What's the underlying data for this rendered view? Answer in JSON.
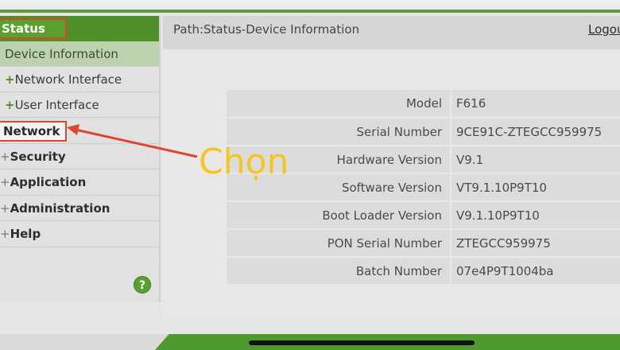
{
  "header": {
    "path": "Path:Status-Device Information",
    "logout": "Logou"
  },
  "sidebar": {
    "status": "Status",
    "sub_items": [
      {
        "label": "Device Information",
        "plus": ""
      },
      {
        "label": "Network Interface",
        "plus": "+"
      },
      {
        "label": "User Interface",
        "plus": "+"
      }
    ],
    "main_items": [
      {
        "label": "Network",
        "dot": ""
      },
      {
        "label": "Security",
        "dot": "+"
      },
      {
        "label": "Application",
        "dot": "+"
      },
      {
        "label": "Administration",
        "dot": "+"
      },
      {
        "label": "Help",
        "dot": "+"
      }
    ],
    "help_icon": "?"
  },
  "device_info": {
    "rows": [
      {
        "label": "Model",
        "value": "F616"
      },
      {
        "label": "Serial Number",
        "value": "9CE91C-ZTEGCC959975"
      },
      {
        "label": "Hardware Version",
        "value": "V9.1"
      },
      {
        "label": "Software Version",
        "value": "VT9.1.10P9T10"
      },
      {
        "label": "Boot Loader Version",
        "value": "V9.1.10P9T10"
      },
      {
        "label": "PON Serial Number",
        "value": "ZTEGCC959975"
      },
      {
        "label": "Batch Number",
        "value": "07e4P9T1004ba"
      }
    ]
  },
  "annotation": {
    "text": "Chọn",
    "color": "#f3c623",
    "arrow_color": "#e0452f"
  },
  "colors": {
    "accent_green": "#4f8f2a",
    "highlight_red": "#d8462d"
  }
}
